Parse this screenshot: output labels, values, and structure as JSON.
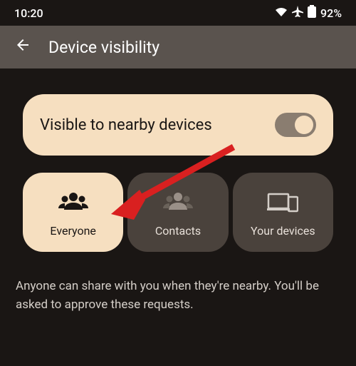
{
  "status_bar": {
    "time": "10:20",
    "battery": "92%"
  },
  "header": {
    "title": "Device visibility"
  },
  "toggle": {
    "label": "Visible to nearby devices",
    "enabled": true
  },
  "options": {
    "everyone": {
      "label": "Everyone"
    },
    "contacts": {
      "label": "Contacts"
    },
    "your_devices": {
      "label": "Your devices"
    }
  },
  "description": "Anyone can share with you when they're nearby. You'll be asked to approve these requests."
}
